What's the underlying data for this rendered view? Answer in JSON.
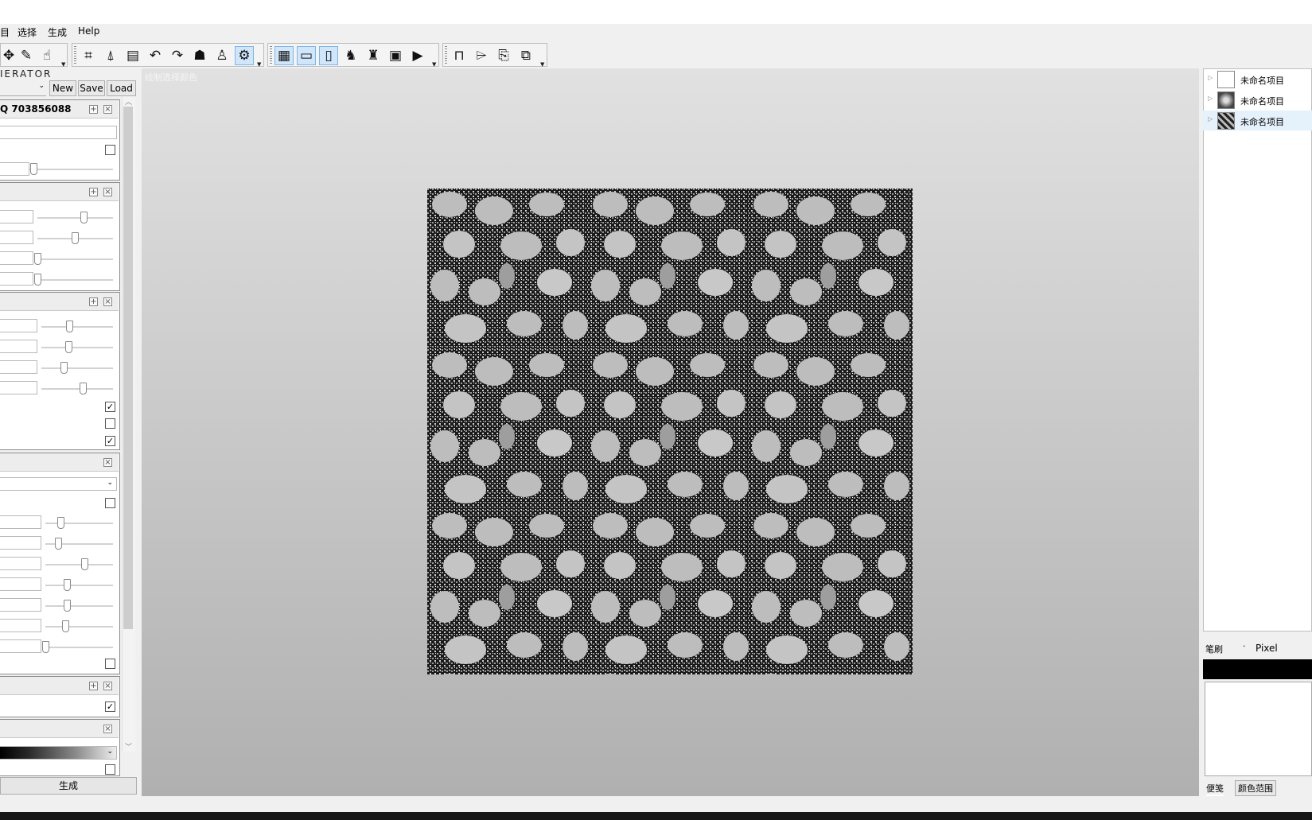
{
  "menu": {
    "items": [
      {
        "label": "目"
      },
      {
        "label": "选择"
      },
      {
        "label": "生成"
      },
      {
        "label": "Help"
      }
    ]
  },
  "toolbar": {
    "groups": [
      {
        "icons": [
          "move-tool-icon",
          "brush-tool-icon",
          "hand-tool-icon"
        ]
      },
      {
        "icons": [
          "crop-icon",
          "flip-icon",
          "gradient-icon",
          "rotate-left-icon",
          "rotate-right-icon",
          "group-icon",
          "person-icon",
          "gear-icon"
        ]
      },
      {
        "icons": [
          "grid-icon",
          "frame-icon",
          "frame-vertical-icon",
          "run-icon",
          "walk-icon",
          "film-icon",
          "play-icon"
        ]
      },
      {
        "icons": [
          "stamp-icon",
          "tag-icon",
          "export-icon",
          "export-all-icon"
        ]
      }
    ]
  },
  "generator": {
    "title": "IERATOR",
    "buttons": {
      "new": "New",
      "save": "Save",
      "load": "Load"
    },
    "panel1_title": "Q 703856088"
  },
  "canvas": {
    "hint": "绘制选择颜色"
  },
  "layers": [
    {
      "name": "未命名项目"
    },
    {
      "name": "未命名项目"
    },
    {
      "name": "未命名项目"
    }
  ],
  "brush": {
    "label": "笔刷",
    "value": "Pixel"
  },
  "tabs": {
    "notes": "便笺",
    "color_range": "颜色范围"
  },
  "footer": {
    "generate": "生成"
  },
  "colors": {
    "accent_selected": "#cfe6fb",
    "layer_selected": "#e5f1fb"
  }
}
